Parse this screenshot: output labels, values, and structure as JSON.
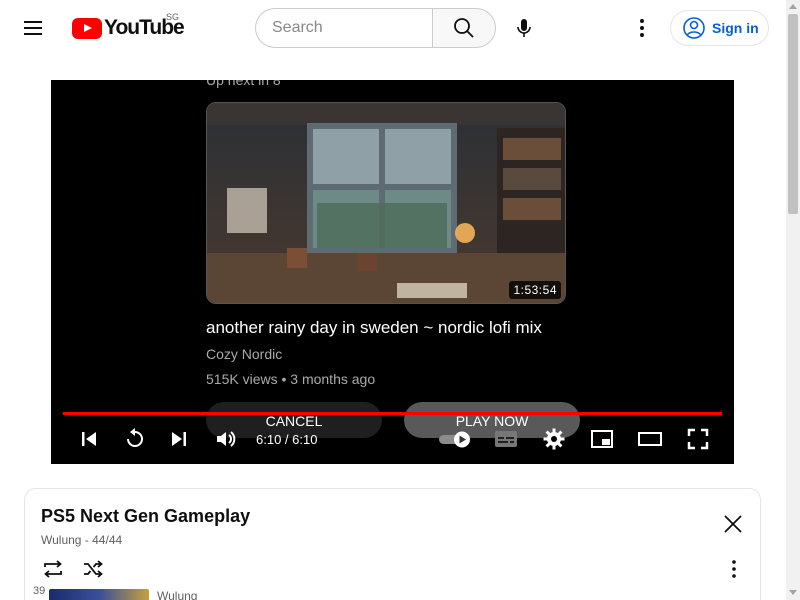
{
  "header": {
    "logo_text": "YouTube",
    "country_code": "SG",
    "search_placeholder": "Search",
    "signin_label": "Sign in"
  },
  "player": {
    "upnext_label": "Up next in 8",
    "upnext_title": "another rainy day in sweden ~ nordic lofi mix",
    "upnext_channel": "Cozy Nordic",
    "upnext_meta": "515K views • 3 months ago",
    "upnext_duration": "1:53:54",
    "cancel_label": "CANCEL",
    "play_now_label": "PLAY NOW",
    "time": "6:10 / 6:10",
    "progress": 1.0
  },
  "playlist": {
    "title": "PS5 Next Gen Gameplay",
    "subtitle": "Wulung - 44/44",
    "items": [
      {
        "index": "39",
        "channel": "Wulung"
      }
    ]
  },
  "colors": {
    "brand_red": "#ff0000",
    "link_blue": "#065fd4"
  },
  "icons": {
    "menu": "hamburger-icon",
    "search": "search-icon",
    "mic": "mic-icon",
    "more": "more-vert-icon",
    "account": "account-circle-icon"
  }
}
